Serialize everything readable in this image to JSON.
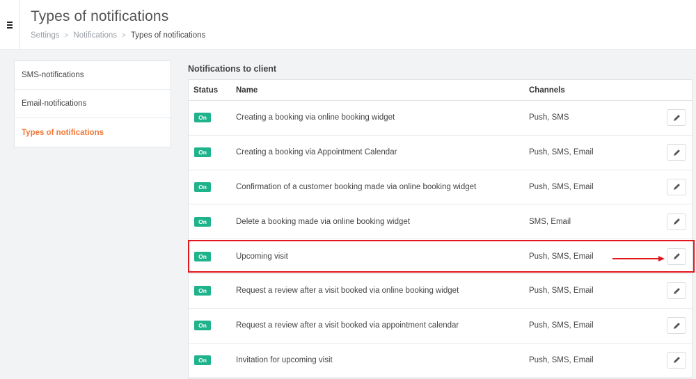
{
  "header": {
    "title": "Types of notifications",
    "breadcrumb": [
      "Settings",
      "Notifications",
      "Types of notifications"
    ],
    "breadcrumb_separator": ">"
  },
  "sidebar": {
    "items": [
      {
        "label": "SMS-notifications"
      },
      {
        "label": "Email-notifications"
      },
      {
        "label": "Types of notifications"
      }
    ],
    "active_color": "#f0783a"
  },
  "section": {
    "title": "Notifications to client"
  },
  "table": {
    "columns": [
      "Status",
      "Name",
      "Channels"
    ],
    "rows": [
      {
        "status": "On",
        "name": "Creating a booking via online booking widget",
        "channels": "Push, SMS",
        "edit_icon": "pencil-icon"
      },
      {
        "status": "On",
        "name": "Creating a booking via Appointment Calendar",
        "channels": "Push, SMS, Email",
        "edit_icon": "pencil-icon"
      },
      {
        "status": "On",
        "name": "Confirmation of a customer booking made via online booking widget",
        "channels": "Push, SMS, Email",
        "edit_icon": "pencil-icon"
      },
      {
        "status": "On",
        "name": "Delete a booking made via online booking widget",
        "channels": "SMS, Email",
        "edit_icon": "pencil-icon"
      },
      {
        "status": "On",
        "name": "Upcoming visit",
        "channels": "Push, SMS, Email",
        "edit_icon": "pencil-icon"
      },
      {
        "status": "On",
        "name": "Request a review after a visit booked via online booking widget",
        "channels": "Push, SMS, Email",
        "edit_icon": "pencil-icon"
      },
      {
        "status": "On",
        "name": "Request a review after a visit booked via appointment calendar",
        "channels": "Push, SMS, Email",
        "edit_icon": "pencil-icon"
      },
      {
        "status": "On",
        "name": "Invitation for upcoming visit",
        "channels": "Push, SMS, Email",
        "edit_icon": "pencil-icon"
      }
    ],
    "status_color": "#1fb38b"
  },
  "annotation": {
    "highlighted_row": "Upcoming visit",
    "color": "#e2161d"
  }
}
